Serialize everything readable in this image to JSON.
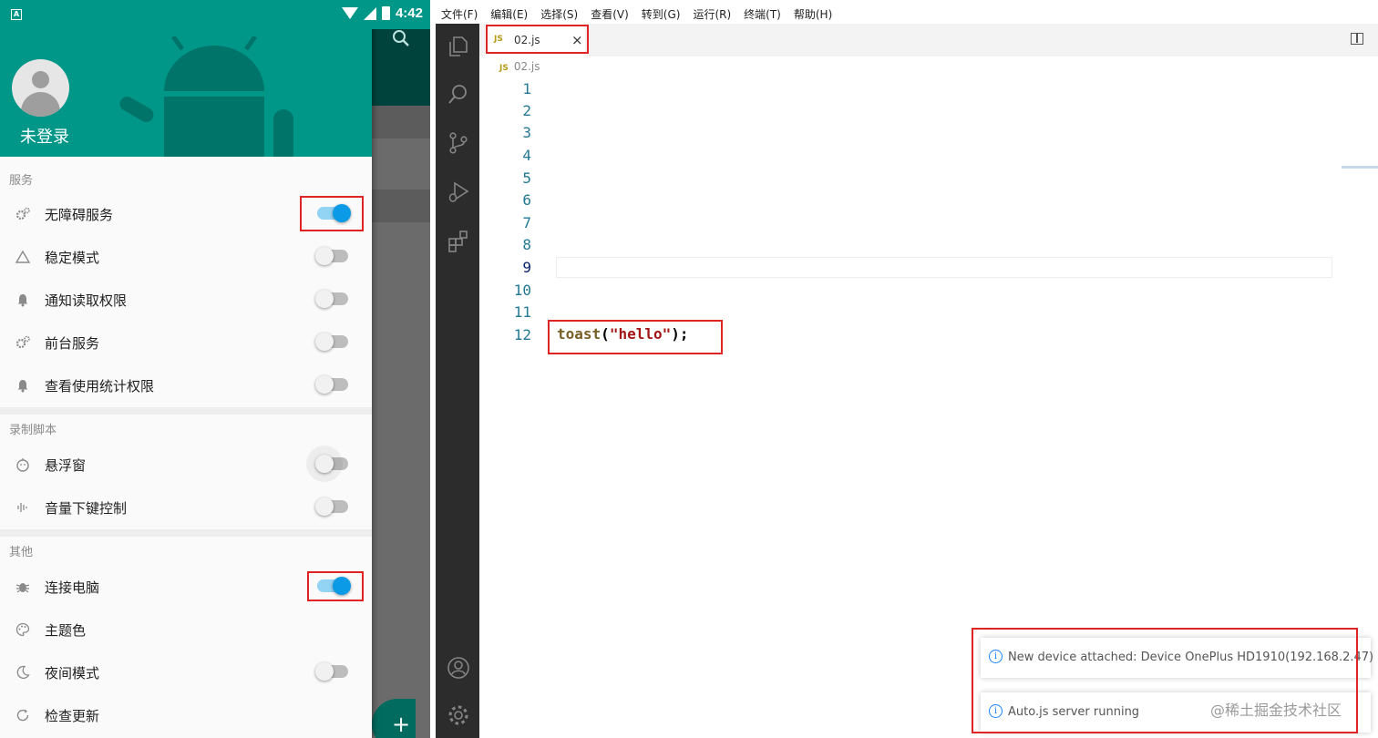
{
  "phone": {
    "status_time": "4:42",
    "status_badge": "A",
    "header": {
      "login_label": "未登录"
    },
    "sections": [
      {
        "label": "服务",
        "items": [
          {
            "label": "无障碍服务",
            "icon": "gears-icon",
            "switch": true
          },
          {
            "label": "稳定模式",
            "icon": "triangle-icon",
            "switch": false
          },
          {
            "label": "通知读取权限",
            "icon": "bell-icon",
            "switch": false
          },
          {
            "label": "前台服务",
            "icon": "gears-icon",
            "switch": false
          },
          {
            "label": "查看使用统计权限",
            "icon": "bell-icon",
            "switch": false
          }
        ]
      },
      {
        "label": "录制脚本",
        "items": [
          {
            "label": "悬浮窗",
            "icon": "face-icon",
            "switch": false
          },
          {
            "label": "音量下键控制",
            "icon": "waveform-icon",
            "switch": false
          }
        ]
      },
      {
        "label": "其他",
        "items": [
          {
            "label": "连接电脑",
            "icon": "bug-icon",
            "switch": true
          },
          {
            "label": "主题色",
            "icon": "palette-icon"
          },
          {
            "label": "夜间模式",
            "icon": "moon-icon",
            "switch": false
          },
          {
            "label": "检查更新",
            "icon": "refresh-icon"
          }
        ]
      }
    ],
    "fab_label": "+"
  },
  "vscode": {
    "menu": [
      "文件(F)",
      "编辑(E)",
      "选择(S)",
      "查看(V)",
      "转到(G)",
      "运行(R)",
      "终端(T)",
      "帮助(H)"
    ],
    "tab": {
      "badge": "JS",
      "label": "02.js",
      "close": "×"
    },
    "breadcrumb": {
      "badge": "JS",
      "label": "02.js"
    },
    "line_numbers": [
      "1",
      "2",
      "3",
      "4",
      "5",
      "6",
      "7",
      "8",
      "9",
      "10",
      "11",
      "12"
    ],
    "active_line": 9,
    "code": {
      "fn": "toast",
      "open": "(",
      "str": "\"hello\"",
      "close": ");"
    },
    "notifications": [
      {
        "icon": "info-icon",
        "message": "New device attached: Device OnePlus HD1910(192.168.2.47)"
      },
      {
        "icon": "info-icon",
        "message": "Auto.js server running"
      }
    ],
    "watermark": "@稀土掘金技术社区"
  },
  "colors": {
    "teal": "#009688",
    "switch_on": "#0a9ae6",
    "highlight": "#e02424",
    "activity_bar": "#2c2c2c"
  }
}
